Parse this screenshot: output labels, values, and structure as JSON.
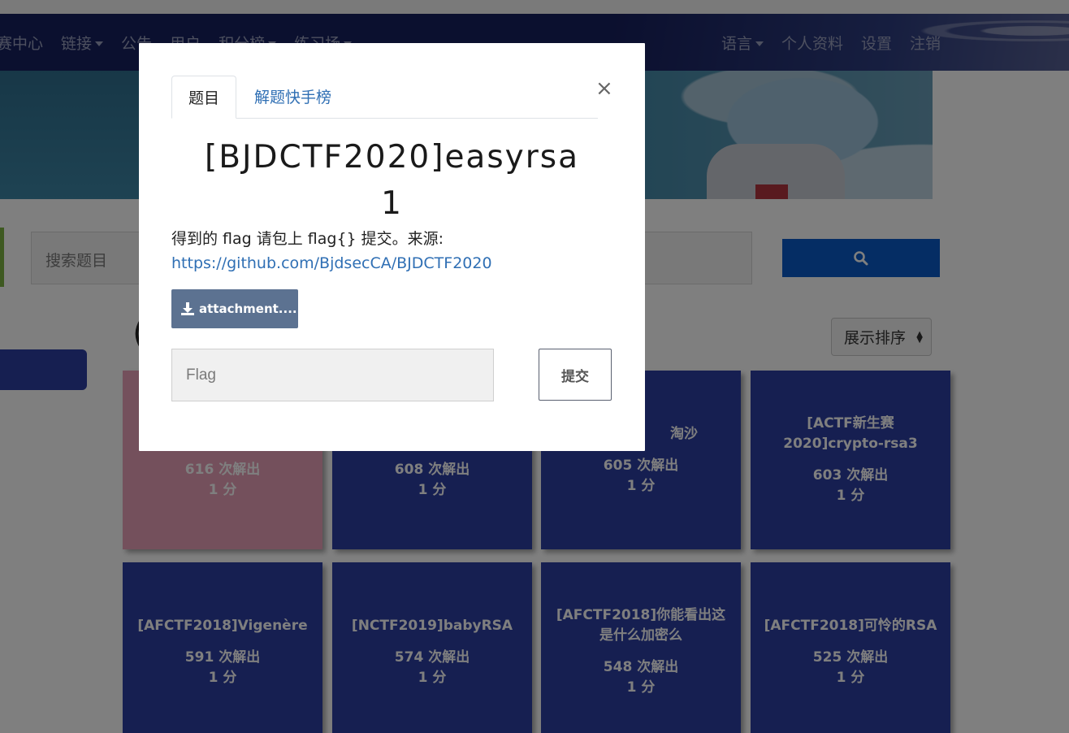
{
  "navbar": {
    "left_items": [
      {
        "label": "赛中心",
        "dropdown": false
      },
      {
        "label": "链接",
        "dropdown": true
      },
      {
        "label": "公告",
        "dropdown": false
      },
      {
        "label": "用户",
        "dropdown": false
      },
      {
        "label": "积分榜",
        "dropdown": true
      },
      {
        "label": "练习场",
        "dropdown": true
      }
    ],
    "right_items": [
      {
        "label": "语言",
        "dropdown": true
      },
      {
        "label": "个人资料",
        "dropdown": false
      },
      {
        "label": "设置",
        "dropdown": false
      },
      {
        "label": "注销",
        "dropdown": false
      }
    ]
  },
  "search": {
    "placeholder": "搜索题目",
    "button_icon": "search-icon"
  },
  "sort": {
    "selected": "展示排序"
  },
  "cards": [
    {
      "name": "",
      "solves": "616 次解出",
      "points": "1 分",
      "solved": true
    },
    {
      "name": "",
      "solves": "608 次解出",
      "points": "1 分",
      "solved": false
    },
    {
      "name": "淘沙",
      "solves": "605 次解出",
      "points": "1 分",
      "solved": false
    },
    {
      "name": "[ACTF新生赛2020]crypto-rsa3",
      "solves": "603 次解出",
      "points": "1 分",
      "solved": false
    },
    {
      "name": "[AFCTF2018]Vigenère",
      "solves": "591 次解出",
      "points": "1 分",
      "solved": false
    },
    {
      "name": "[NCTF2019]babyRSA",
      "solves": "574 次解出",
      "points": "1 分",
      "solved": false
    },
    {
      "name": "[AFCTF2018]你能看出这是什么加密么",
      "solves": "548 次解出",
      "points": "1 分",
      "solved": false
    },
    {
      "name": "[AFCTF2018]可怜的RSA",
      "solves": "525 次解出",
      "points": "1 分",
      "solved": false
    }
  ],
  "modal": {
    "tabs": [
      {
        "label": "题目",
        "active": true
      },
      {
        "label": "解题快手榜",
        "active": false
      }
    ],
    "close_label": "×",
    "title": "[BJDCTF2020]easyrsa",
    "points": "1",
    "description": "得到的 flag 请包上 flag{} 提交。来源:",
    "source_link": "https://github.com/BjdsecCA/BJDCTF2020",
    "attachment_label": "attachment....",
    "flag_placeholder": "Flag",
    "submit_label": "提交"
  },
  "colors": {
    "navbar": "#17205e",
    "card": "#2c3ea3",
    "card_solved": "#e9a1b9",
    "search_button": "#0a5ac9",
    "attachment_button": "#5c7291",
    "link": "#2f6fb4"
  }
}
